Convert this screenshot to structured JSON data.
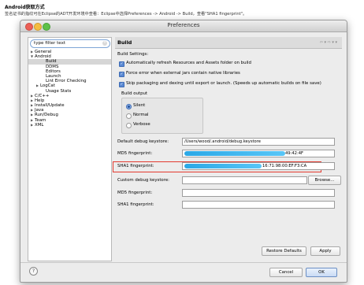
{
  "doc": {
    "title": "Android获取方式",
    "description": "签名证书的指纹可在Eclipse的ADT开发环境中查看：Eclipse中选择Preferences -> Android -> Build，查看\"SHA1 fingerprint\"。"
  },
  "window": {
    "title": "Preferences",
    "controls": [
      "close",
      "minimize",
      "maximize"
    ]
  },
  "sidebar": {
    "filter_placeholder": "type filter text",
    "items": [
      {
        "label": "General",
        "arrow": "▶",
        "indent": 0
      },
      {
        "label": "Android",
        "arrow": "▼",
        "indent": 0
      },
      {
        "label": "Build",
        "arrow": "",
        "indent": 2,
        "selected": true
      },
      {
        "label": "DDMS",
        "arrow": "",
        "indent": 2
      },
      {
        "label": "Editors",
        "arrow": "",
        "indent": 2
      },
      {
        "label": "Launch",
        "arrow": "",
        "indent": 2
      },
      {
        "label": "Lint Error Checking",
        "arrow": "",
        "indent": 2
      },
      {
        "label": "LogCat",
        "arrow": "▶",
        "indent": 1
      },
      {
        "label": "Usage Stats",
        "arrow": "",
        "indent": 2
      },
      {
        "label": "C/C++",
        "arrow": "▶",
        "indent": 0
      },
      {
        "label": "Help",
        "arrow": "▶",
        "indent": 0
      },
      {
        "label": "Install/Update",
        "arrow": "▶",
        "indent": 0
      },
      {
        "label": "Java",
        "arrow": "▶",
        "indent": 0
      },
      {
        "label": "Run/Debug",
        "arrow": "▶",
        "indent": 0
      },
      {
        "label": "Team",
        "arrow": "▶",
        "indent": 0
      },
      {
        "label": "XML",
        "arrow": "▶",
        "indent": 0
      }
    ]
  },
  "content": {
    "title": "Build",
    "build_settings_label": "Build Settings:",
    "opt_refresh": "Automatically refresh Resources and Assets folder on build",
    "opt_force_error": "Force error when external jars contain native libraries",
    "opt_skip_packaging": "Skip packaging and dexing until export or launch. (Speeds up automatic builds on file save)",
    "build_output_label": "Build output",
    "radio_silent": "Silent",
    "radio_normal": "Normal",
    "radio_verbose": "Verbose",
    "default_keystore_label": "Default debug keystore:",
    "default_keystore_value": "/Users/wood/.android/debug.keystore",
    "md5_label": "MD5 fingerprint:",
    "md5_tail": "49:42:4F",
    "sha1_label": "SHA1 fingerprint:",
    "sha1_tail": "16:71:98:00:EF:F3:CA",
    "custom_keystore_label": "Custom debug keystore:",
    "browse_button": "Browse...",
    "custom_md5_label": "MD5 fingerprint:",
    "custom_sha1_label": "SHA1 fingerprint:",
    "restore_defaults_button": "Restore Defaults",
    "apply_button": "Apply"
  },
  "footer": {
    "help_icon": "?",
    "cancel_button": "Cancel",
    "ok_button": "OK"
  },
  "colors": {
    "highlight_box": "#e33a2f",
    "redaction_mask": "#2aa8e6",
    "checkbox_accent": "#5a89d3"
  }
}
